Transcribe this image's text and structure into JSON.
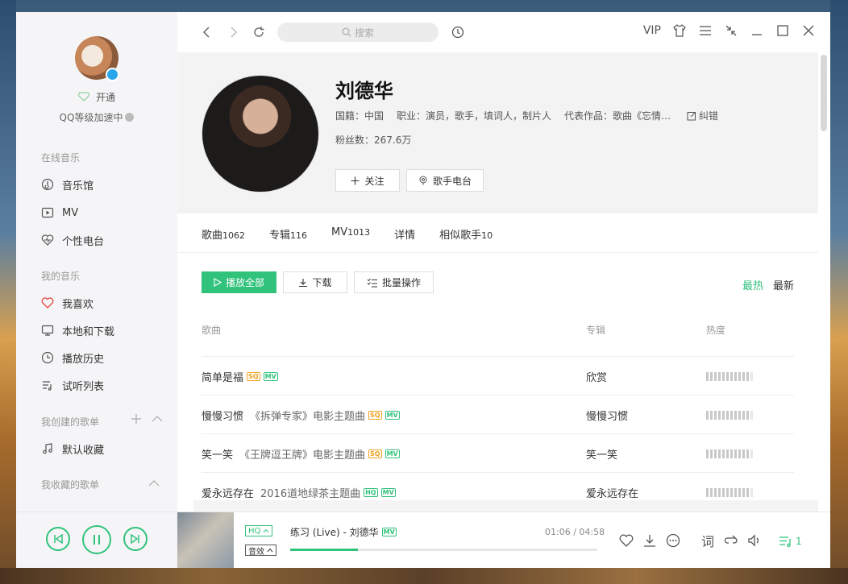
{
  "sidebar": {
    "vip_label": "开通",
    "level_label": "QQ等级加速中",
    "sections": {
      "online": "在线音乐",
      "mine": "我的音乐",
      "created": "我创建的歌单",
      "collected": "我收藏的歌单"
    },
    "online_items": [
      "音乐馆",
      "MV",
      "个性电台"
    ],
    "mine_items": [
      "我喜欢",
      "本地和下载",
      "播放历史",
      "试听列表"
    ],
    "created_items": [
      "默认收藏"
    ]
  },
  "topbar": {
    "search_placeholder": "搜索",
    "vip": "VIP"
  },
  "artist": {
    "name": "刘德华",
    "origin": "国籍：中国",
    "job": "职业：演员，歌手，填词人，制片人",
    "works": "代表作品：歌曲《忘情…",
    "correct": "纠错",
    "fans": "粉丝数：267.6万",
    "follow": "关注",
    "radio": "歌手电台"
  },
  "tabs": [
    {
      "label": "歌曲",
      "count": "1062"
    },
    {
      "label": "专辑",
      "count": "116"
    },
    {
      "label": "MV",
      "count": "1013"
    },
    {
      "label": "详情",
      "count": ""
    },
    {
      "label": "相似歌手",
      "count": "10"
    }
  ],
  "actions": {
    "play_all": "播放全部",
    "download": "下载",
    "batch": "批量操作",
    "sort_hot": "最热",
    "sort_new": "最新"
  },
  "table": {
    "col_song": "歌曲",
    "col_album": "专辑",
    "col_heat": "热度",
    "rows": [
      {
        "title": "简单是福",
        "sub": "",
        "quality": "SQ",
        "album": "欣赏",
        "heat": 0.95
      },
      {
        "title": "慢慢习惯",
        "sub": "《拆弹专家》电影主题曲",
        "quality": "SQ",
        "album": "慢慢习惯",
        "heat": 0.95
      },
      {
        "title": "笑一笑",
        "sub": "《王牌逗王牌》电影主题曲",
        "quality": "SQ",
        "album": "笑一笑",
        "heat": 0.95
      },
      {
        "title": "爱永远存在",
        "sub": "2016道地绿茶主题曲",
        "quality": "HQ",
        "album": "爱永远存在",
        "heat": 0.95
      }
    ]
  },
  "player": {
    "quality": "HQ",
    "effect": "音效",
    "track": "练习 (Live) - 刘德华",
    "time": "01:06 / 04:58",
    "progress": 0.22,
    "lyric": "词",
    "queue_count": "1"
  },
  "colors": {
    "accent": "#31c27c",
    "sq": "#f2a221"
  }
}
